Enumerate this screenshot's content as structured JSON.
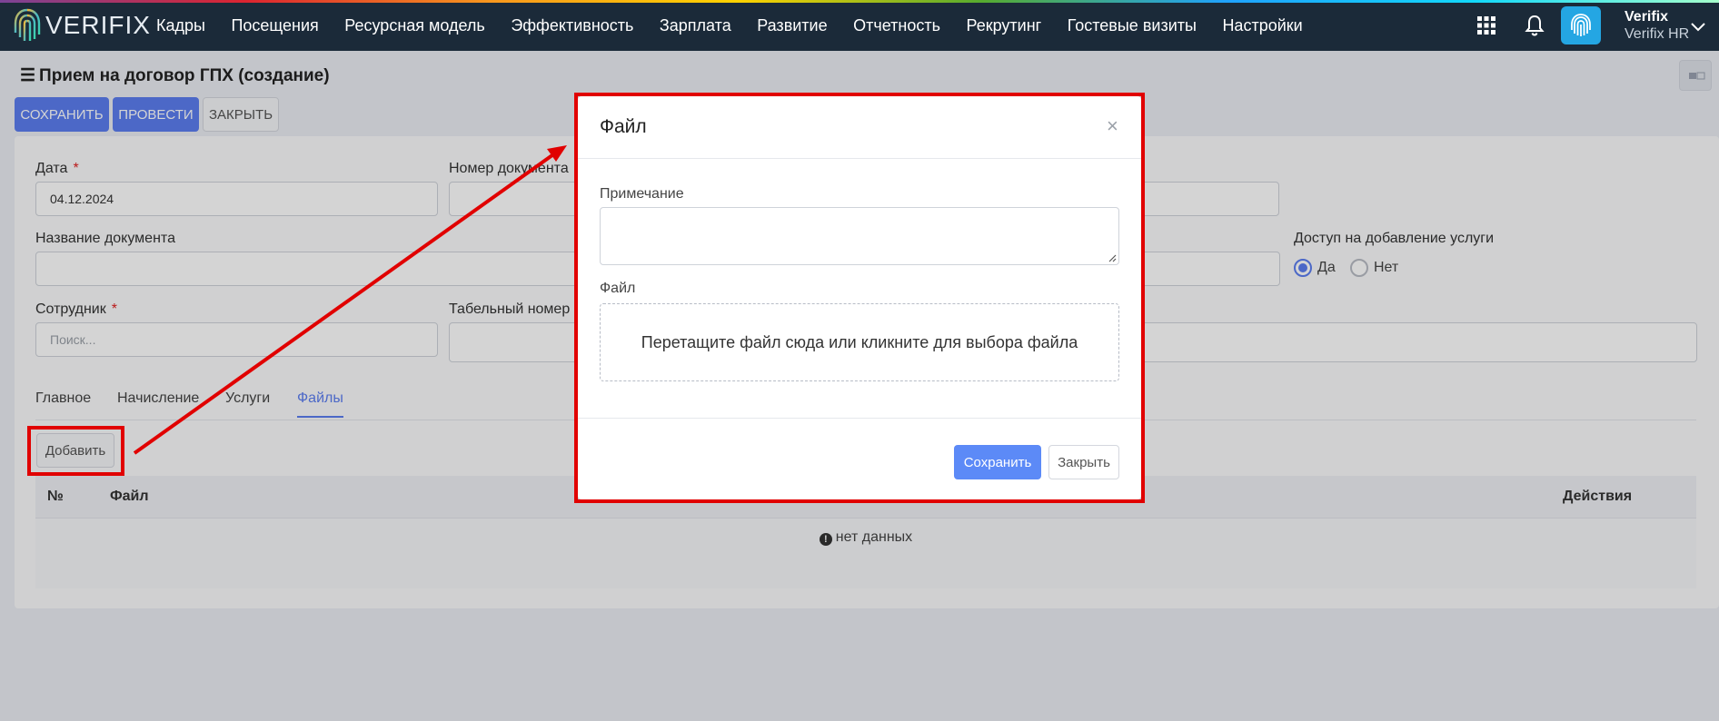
{
  "topbar": {
    "logo_text": "VERIFIX",
    "nav": [
      "Кадры",
      "Посещения",
      "Ресурсная модель",
      "Эффективность",
      "Зарплата",
      "Развитие",
      "Отчетность",
      "Рекрутинг",
      "Гостевые визиты",
      "Настройки"
    ],
    "user_name": "Verifix",
    "user_org": "Verifix HR",
    "icons": {
      "apps": "apps-grid-icon",
      "notifications": "bell-icon",
      "avatar": "fingerprint-icon",
      "menu": "chevron-down-icon"
    }
  },
  "page": {
    "title": "Прием на договор ГПХ (создание)",
    "title_icon": "☰",
    "buttons": {
      "save": "СОХРАНИТЬ",
      "post": "ПРОВЕСТИ",
      "close": "ЗАКРЫТЬ"
    }
  },
  "form": {
    "date_label": "Дата",
    "date_value": "04.12.2024",
    "doc_number_label": "Номер документа",
    "doc_name_label": "Название документа",
    "service_access_label": "Доступ на добавление услуги",
    "radio_yes": "Да",
    "radio_no": "Нет",
    "radio_selected": "Да",
    "employee_label": "Сотрудник",
    "employee_placeholder": "Поиск...",
    "tab_number_label": "Табельный номер",
    "required_mark": "*"
  },
  "tabs": [
    "Главное",
    "Начисление",
    "Услуги",
    "Файлы"
  ],
  "active_tab": "Файлы",
  "files": {
    "add_button": "Добавить",
    "columns": [
      "№",
      "Файл",
      "Действия"
    ],
    "empty_text": "нет данных"
  },
  "modal": {
    "title": "Файл",
    "close_glyph": "×",
    "note_label": "Примечание",
    "file_label": "Файл",
    "drop_text": "Перетащите файл сюда или кликните для выбора файла",
    "save_button": "Сохранить",
    "close_button": "Закрыть"
  },
  "colors": {
    "primary": "#5c7ef0",
    "topbar": "#1b2a39",
    "highlight": "#e10000"
  }
}
